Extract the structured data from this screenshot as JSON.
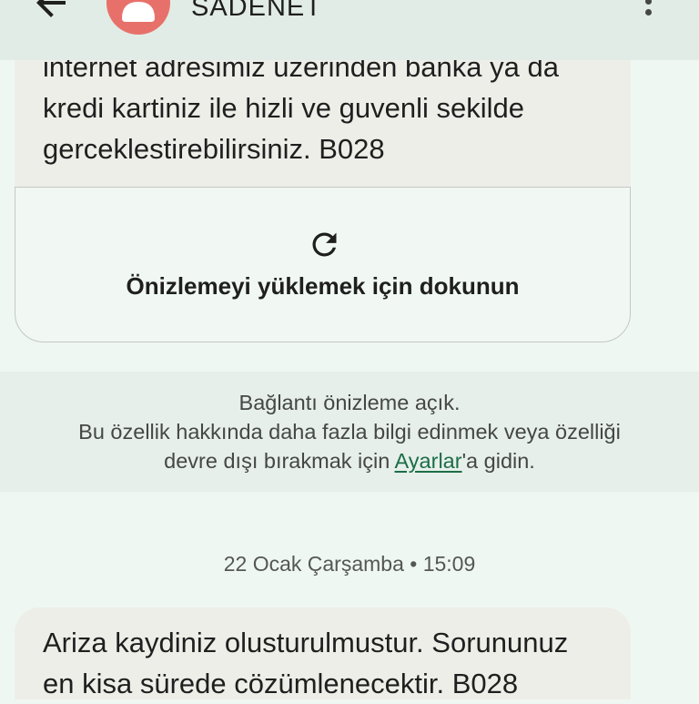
{
  "header": {
    "back_icon": "arrow-back-icon",
    "avatar_icon": "person-icon",
    "avatar_color": "#e7716a",
    "title": "SADENET",
    "menu_icon": "more-vert-icon"
  },
  "message_1": {
    "lines": [
      "internet adresimiz uzerinden banka ya da",
      "kredi kartiniz ile hizli ve guvenli sekilde",
      "gerceklestirebilirsiniz. B028"
    ]
  },
  "link_preview": {
    "refresh_icon": "refresh-icon",
    "label": "Önizlemeyi yüklemek için dokunun"
  },
  "notice": {
    "line_1": "Bağlantı önizleme açık.",
    "line_2": "Bu özellik hakkında daha fazla bilgi edinmek veya özelliği",
    "line_3_before": "devre dışı bırakmak için ",
    "link": "Ayarlar",
    "line_3_after": "'a gidin."
  },
  "timestamp": "22 Ocak Çarşamba • 15:09",
  "message_2": {
    "lines": [
      "Ariza kaydiniz olusturulmustur. Sorununuz",
      "en kisa sürede cözümlenecektir. B028"
    ]
  },
  "colors": {
    "background": "#eff7f2",
    "header": "#e2ece6",
    "bubble": "#eeeee9",
    "notice_band": "#e7efea",
    "link": "#1b6e47",
    "text": "#1f1f1f"
  }
}
